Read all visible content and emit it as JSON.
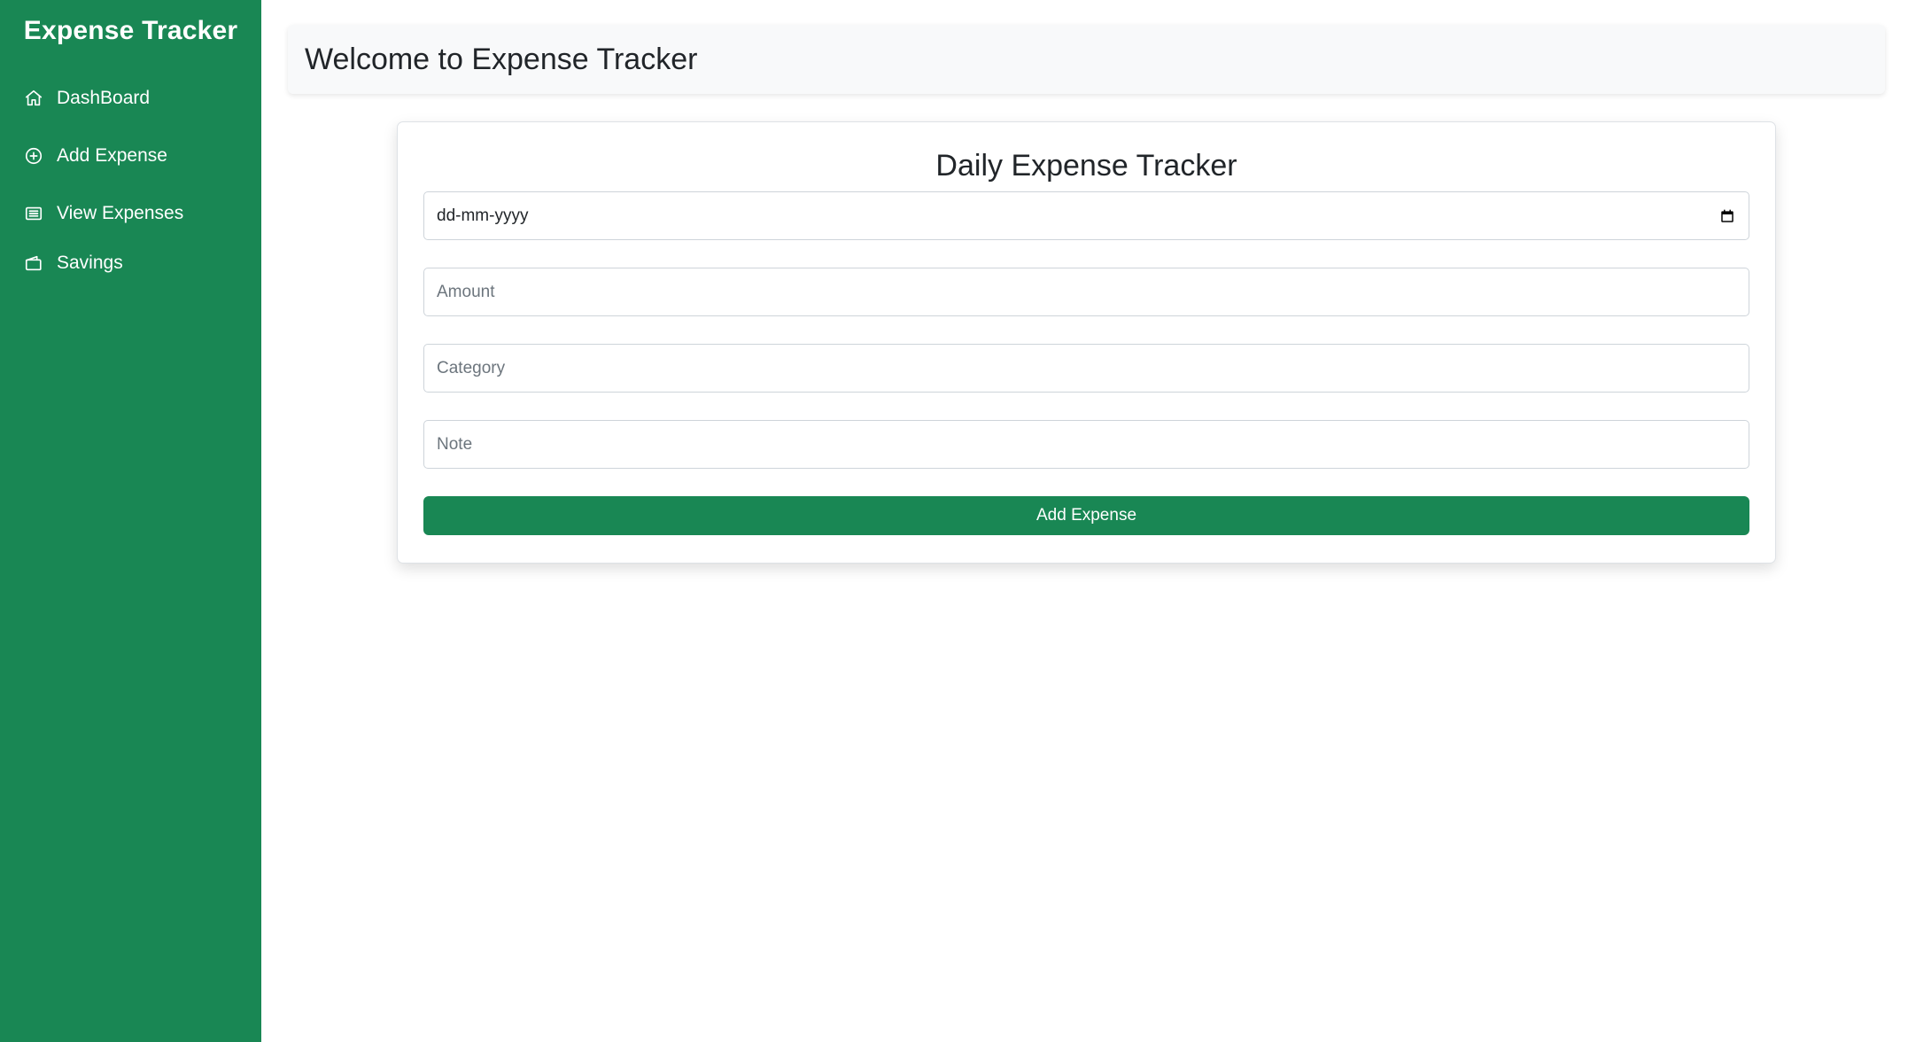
{
  "app": {
    "brand": "Expense Tracker"
  },
  "sidebar": {
    "items": [
      {
        "label": "DashBoard",
        "icon": "home-icon"
      },
      {
        "label": "Add Expense",
        "icon": "plus-circle-icon"
      },
      {
        "label": "View Expenses",
        "icon": "list-icon"
      },
      {
        "label": "Savings",
        "icon": "wallet-icon"
      }
    ]
  },
  "header": {
    "title": "Welcome to Expense Tracker"
  },
  "form": {
    "title": "Daily Expense Tracker",
    "date_placeholder": "dd-mm-yyyy",
    "amount_placeholder": "Amount",
    "category_placeholder": "Category",
    "note_placeholder": "Note",
    "submit_label": "Add Expense"
  },
  "colors": {
    "sidebar_bg": "#198754",
    "button_bg": "#198754",
    "header_bg": "#f8f9fa"
  }
}
